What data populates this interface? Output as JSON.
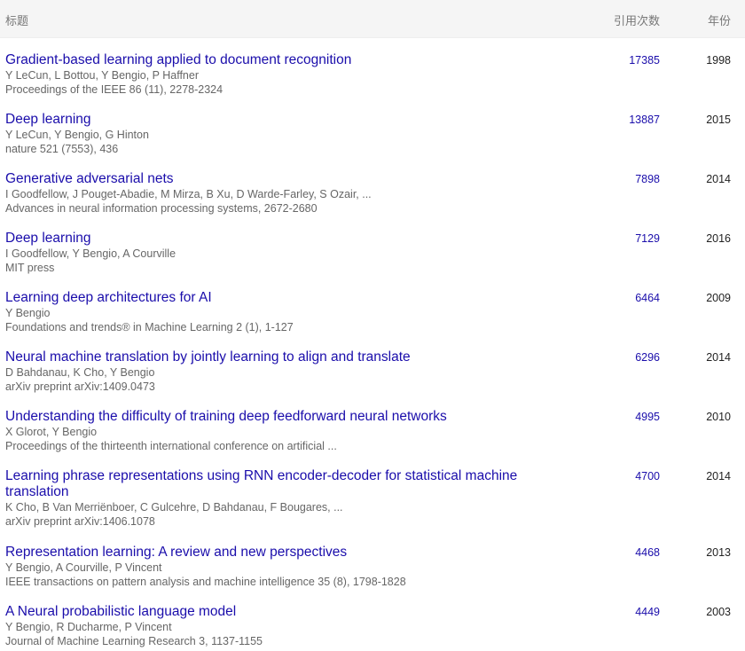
{
  "header": {
    "title_col": "标题",
    "cites_col": "引用次数",
    "year_col": "年份"
  },
  "papers": [
    {
      "title": "Gradient-based learning applied to document recognition",
      "authors": "Y LeCun, L Bottou, Y Bengio, P Haffner",
      "venue": "Proceedings of the IEEE 86 (11), 2278-2324",
      "cites": "17385",
      "year": "1998"
    },
    {
      "title": "Deep learning",
      "authors": "Y LeCun, Y Bengio, G Hinton",
      "venue": "nature 521 (7553), 436",
      "cites": "13887",
      "year": "2015"
    },
    {
      "title": "Generative adversarial nets",
      "authors": "I Goodfellow, J Pouget-Abadie, M Mirza, B Xu, D Warde-Farley, S Ozair, ...",
      "venue": "Advances in neural information processing systems, 2672-2680",
      "cites": "7898",
      "year": "2014"
    },
    {
      "title": "Deep learning",
      "authors": "I Goodfellow, Y Bengio, A Courville",
      "venue": "MIT press",
      "cites": "7129",
      "year": "2016"
    },
    {
      "title": "Learning deep architectures for AI",
      "authors": "Y Bengio",
      "venue": "Foundations and trends® in Machine Learning 2 (1), 1-127",
      "cites": "6464",
      "year": "2009"
    },
    {
      "title": "Neural machine translation by jointly learning to align and translate",
      "authors": "D Bahdanau, K Cho, Y Bengio",
      "venue": "arXiv preprint arXiv:1409.0473",
      "cites": "6296",
      "year": "2014"
    },
    {
      "title": "Understanding the difficulty of training deep feedforward neural networks",
      "authors": "X Glorot, Y Bengio",
      "venue": "Proceedings of the thirteenth international conference on artificial ...",
      "cites": "4995",
      "year": "2010"
    },
    {
      "title": "Learning phrase representations using RNN encoder-decoder for statistical machine translation",
      "authors": "K Cho, B Van Merriënboer, C Gulcehre, D Bahdanau, F Bougares, ...",
      "venue": "arXiv preprint arXiv:1406.1078",
      "cites": "4700",
      "year": "2014"
    },
    {
      "title": "Representation learning: A review and new perspectives",
      "authors": "Y Bengio, A Courville, P Vincent",
      "venue": "IEEE transactions on pattern analysis and machine intelligence 35 (8), 1798-1828",
      "cites": "4468",
      "year": "2013"
    },
    {
      "title": "A Neural probabilistic language model",
      "authors": "Y Bengio, R Ducharme, P Vincent",
      "venue": "Journal of Machine Learning Research 3, 1137-1155",
      "cites": "4449",
      "year": "2003"
    }
  ]
}
